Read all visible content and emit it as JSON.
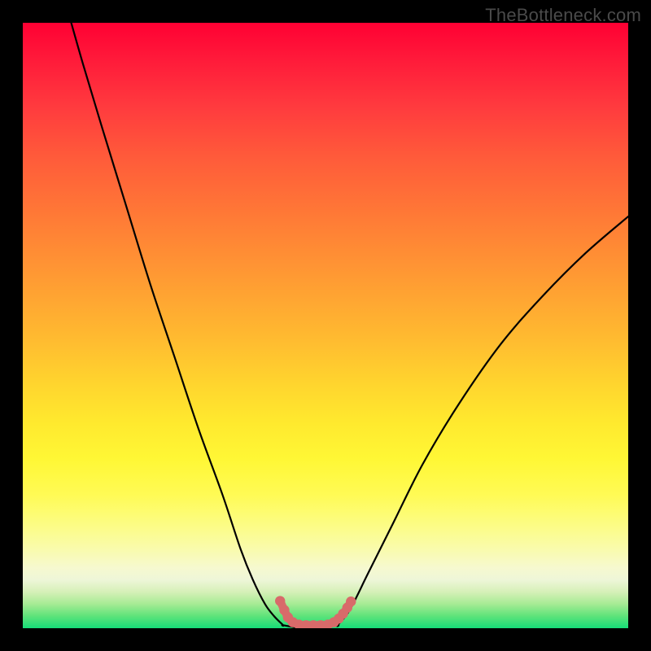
{
  "watermark": "TheBottleneck.com",
  "colors": {
    "frame": "#000000",
    "curve_stroke": "#000000",
    "marker_fill": "#d86a6a",
    "marker_stroke": "#c85656",
    "gradient_top": "#ff0033",
    "gradient_bottom": "#16dd78"
  },
  "chart_data": {
    "type": "line",
    "title": "",
    "xlabel": "",
    "ylabel": "",
    "xlim": [
      0,
      100
    ],
    "ylim": [
      0,
      100
    ],
    "grid": false,
    "legend": false,
    "series": [
      {
        "name": "curve-left",
        "x": [
          8,
          10,
          13,
          17,
          21,
          25,
          29,
          33,
          36,
          38,
          40,
          41.5,
          43
        ],
        "y": [
          100,
          93,
          83,
          70,
          57,
          45,
          33,
          22,
          13,
          8,
          4,
          2,
          0.5
        ]
      },
      {
        "name": "curve-right",
        "x": [
          52,
          54,
          57,
          61,
          66,
          72,
          79,
          86,
          93,
          100
        ],
        "y": [
          0.5,
          3,
          9,
          17,
          27,
          37,
          47,
          55,
          62,
          68
        ]
      },
      {
        "name": "floor",
        "x": [
          43,
          46,
          49,
          52
        ],
        "y": [
          0.5,
          0,
          0,
          0.5
        ]
      }
    ],
    "markers": {
      "name": "salmon-dots",
      "points": [
        {
          "x": 42.5,
          "y": 4.5
        },
        {
          "x": 43.2,
          "y": 3.0
        },
        {
          "x": 43.8,
          "y": 1.8
        },
        {
          "x": 44.6,
          "y": 1.0
        },
        {
          "x": 45.6,
          "y": 0.6
        },
        {
          "x": 46.8,
          "y": 0.5
        },
        {
          "x": 48.0,
          "y": 0.5
        },
        {
          "x": 49.2,
          "y": 0.5
        },
        {
          "x": 50.4,
          "y": 0.6
        },
        {
          "x": 51.4,
          "y": 1.0
        },
        {
          "x": 52.2,
          "y": 1.6
        },
        {
          "x": 52.9,
          "y": 2.4
        },
        {
          "x": 53.6,
          "y": 3.4
        },
        {
          "x": 54.2,
          "y": 4.4
        }
      ]
    }
  }
}
